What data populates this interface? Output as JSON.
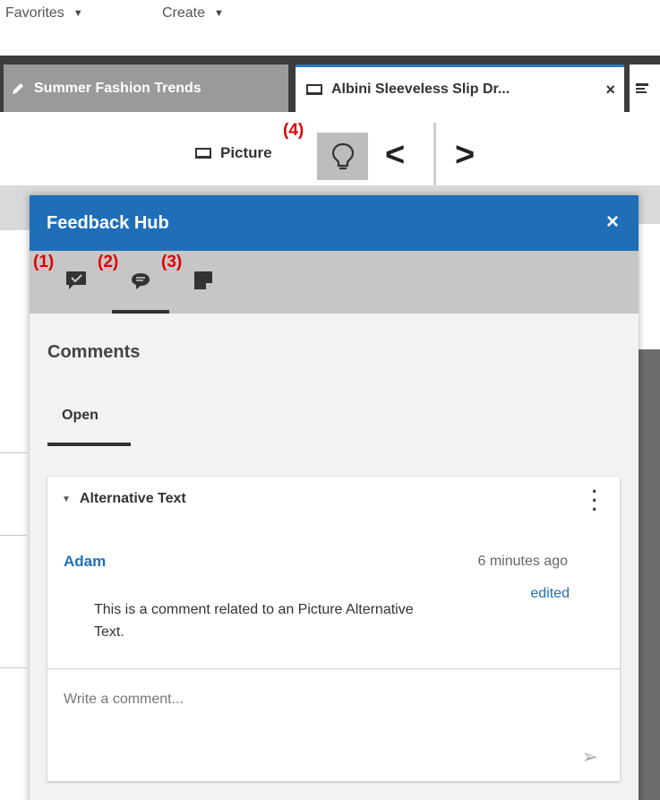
{
  "top_menu": {
    "favorites": "Favorites",
    "create": "Create"
  },
  "tabs": [
    {
      "label": "Summer Fashion Trends",
      "icon": "pencil-icon"
    },
    {
      "label": "Albini Sleeveless Slip Dr...",
      "icon": "screen-icon",
      "close": "×"
    }
  ],
  "toolbar": {
    "picture_label": "Picture",
    "bulb_icon": "lightbulb-icon",
    "prev": "<",
    "next": ">"
  },
  "annotations": [
    "(1)",
    "(2)",
    "(3)",
    "(4)"
  ],
  "hub": {
    "title": "Feedback Hub",
    "close": "×",
    "icons": [
      "comment-check-icon",
      "comment-icon",
      "note-icon"
    ],
    "section_title": "Comments",
    "open_tab": "Open",
    "card": {
      "heading": "Alternative Text",
      "author": "Adam",
      "time": "6 minutes ago",
      "edited": "edited",
      "comment": "This is a comment related to an Picture Alternative Text.",
      "placeholder": "Write a comment...",
      "send": "➢"
    }
  },
  "colors": {
    "accent": "#1f6fb8",
    "tabbar": "#3c3c3c",
    "annotation": "#e00000"
  }
}
